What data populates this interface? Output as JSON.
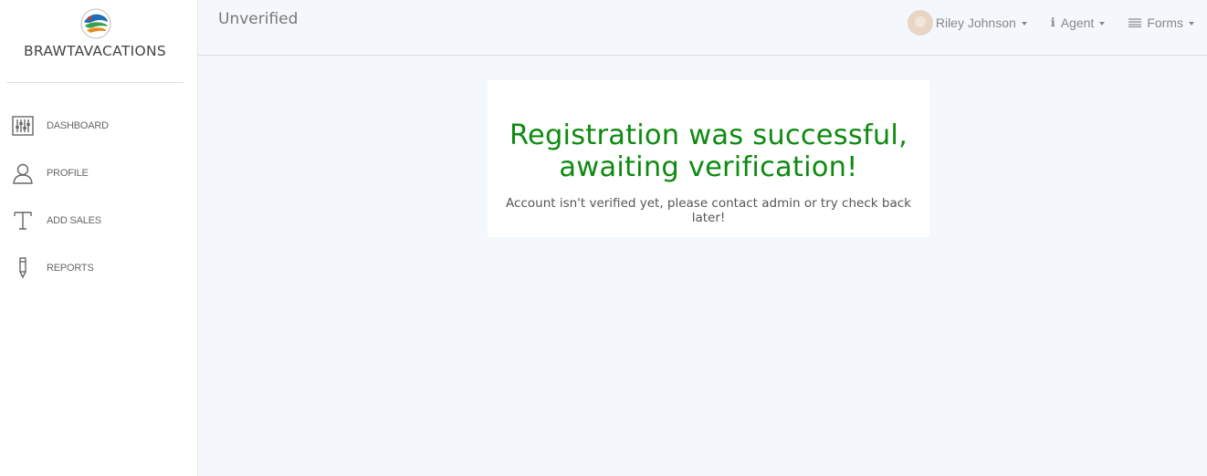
{
  "brand": {
    "name": "BRAWTAVACATIONS",
    "logo_icon": "globe-logo-icon"
  },
  "sidebar": {
    "items": [
      {
        "label": "DASHBOARD",
        "icon": "sliders-icon"
      },
      {
        "label": "PROFILE",
        "icon": "user-icon"
      },
      {
        "label": "ADD SALES",
        "icon": "text-t-icon"
      },
      {
        "label": "REPORTS",
        "icon": "pen-icon"
      }
    ]
  },
  "header": {
    "title": "Unverified",
    "user_name": "Riley Johnson",
    "agent_label": "Agent",
    "forms_label": "Forms"
  },
  "main": {
    "title": "Registration was successful, awaiting verification!",
    "message": "Account isn't verified yet, please contact admin or try check back later!"
  },
  "colors": {
    "success": "#0e8a10",
    "background": "#f4f7fc"
  }
}
